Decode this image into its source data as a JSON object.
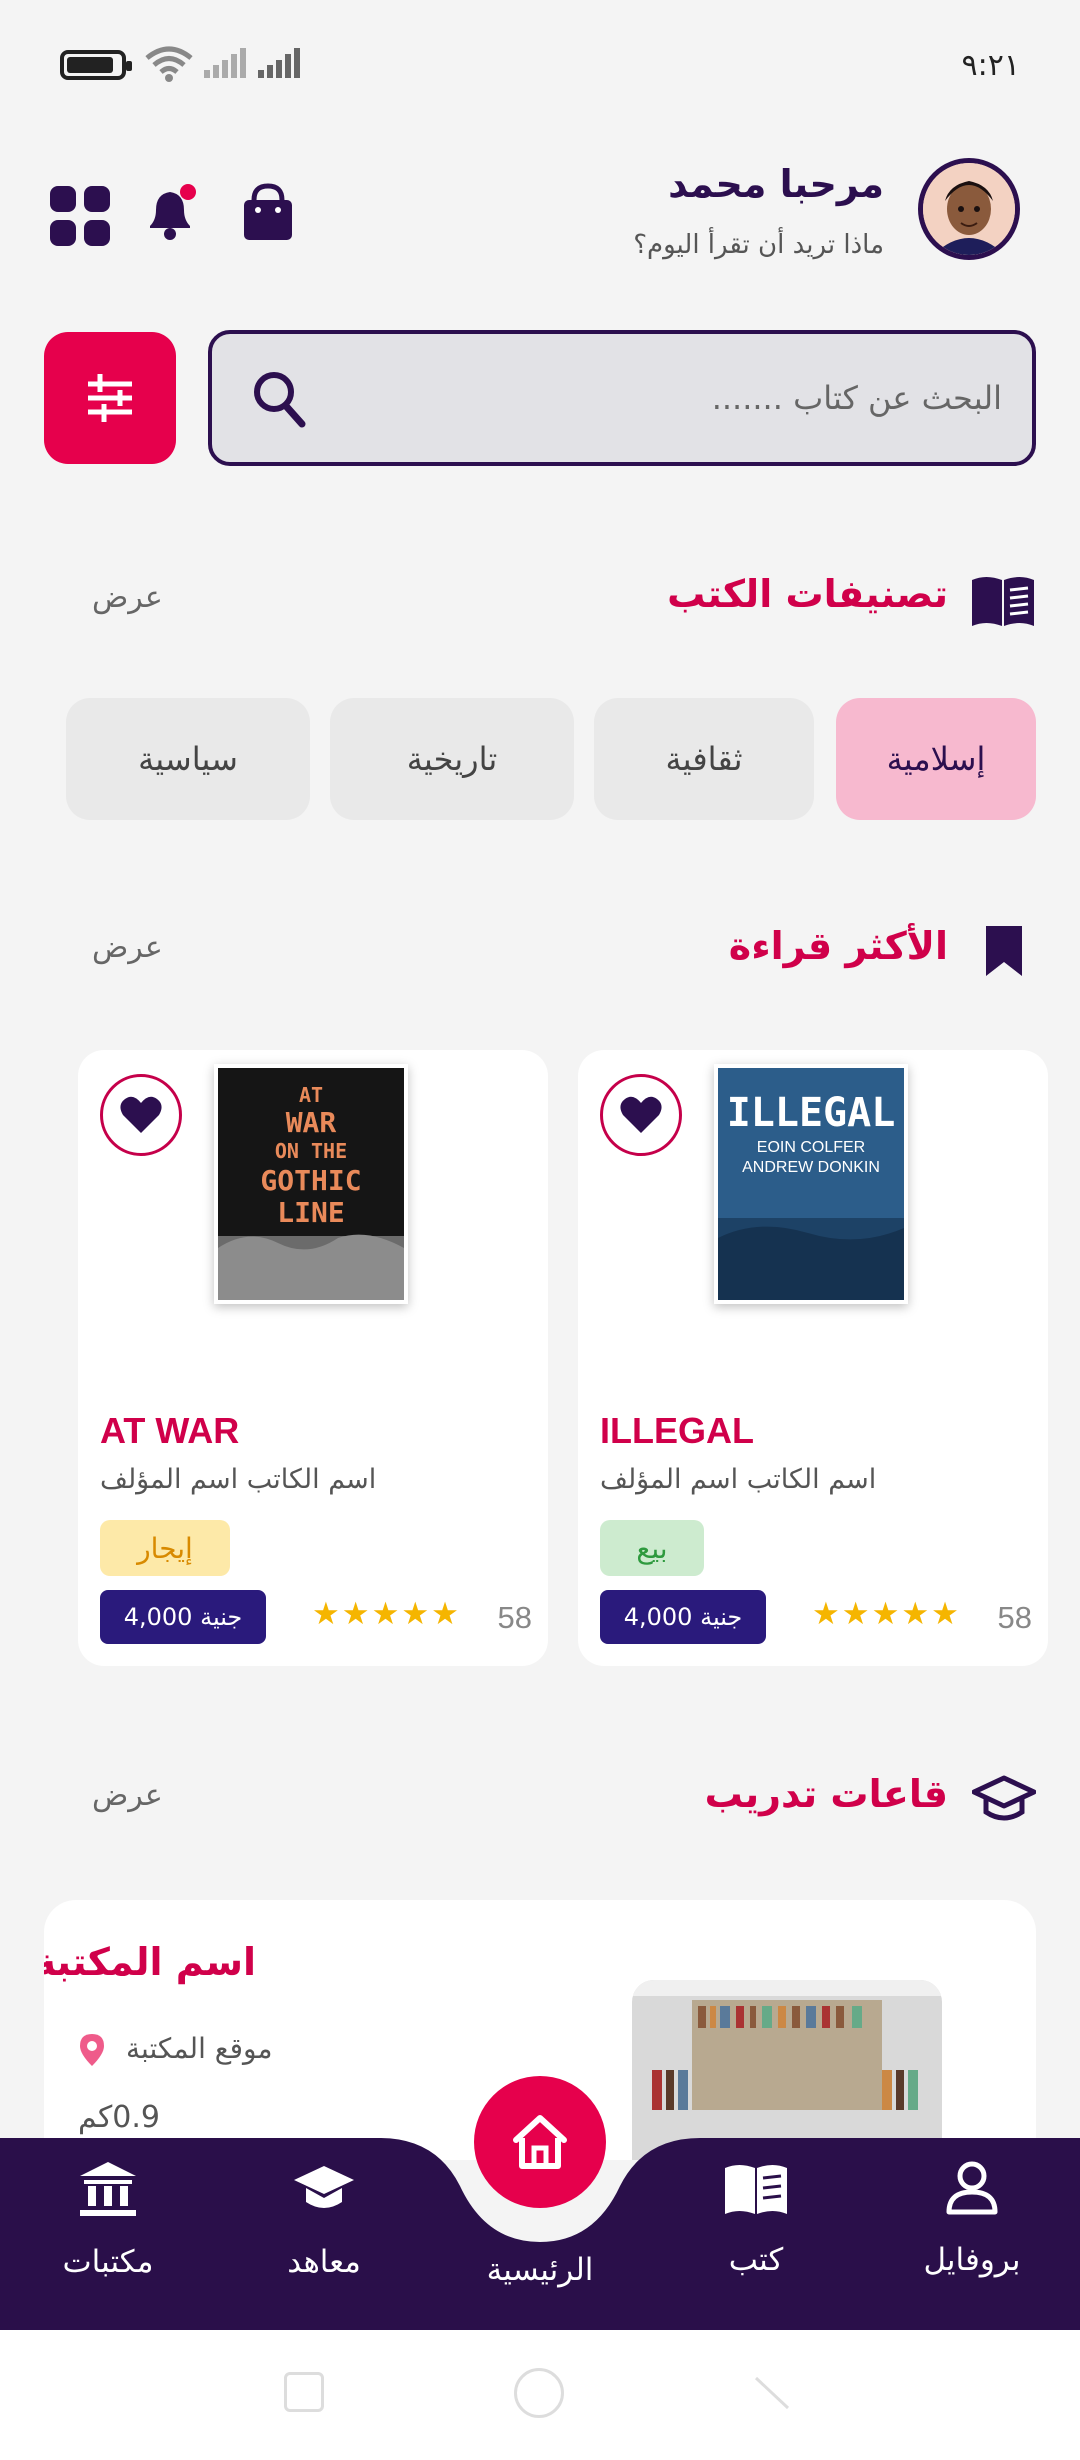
{
  "status_bar": {
    "time": "٩:٢١"
  },
  "header": {
    "greeting": "مرحبا محمد",
    "subtitle": "ماذا تريد أن تقرأ اليوم؟"
  },
  "search": {
    "placeholder": "البحث عن كتاب ......."
  },
  "categories_section": {
    "title": "تصنيفات الكتب",
    "more": "عرض",
    "items": [
      {
        "label": "إسلامية",
        "active": true
      },
      {
        "label": "ثقافية"
      },
      {
        "label": "تاريخية"
      },
      {
        "label": "سياسية"
      }
    ]
  },
  "most_read_section": {
    "title": "الأكثر قراءة",
    "more": "عرض",
    "books": [
      {
        "title": "ILLEGAL",
        "author": "اسم الكاتب اسم المؤلف",
        "type": "بيع",
        "price": "4,000 جنية",
        "rating_count": "58",
        "cover_lines": [
          "ILLEGAL",
          "EOIN COLFER",
          "ANDREW DONKIN"
        ],
        "type_color": "#2e9a3e"
      },
      {
        "title": "AT WAR",
        "author": "اسم الكاتب اسم المؤلف",
        "type": "إيجار",
        "price": "4,000 جنية",
        "rating_count": "58",
        "cover_lines": [
          "AT",
          "WAR",
          "ON THE",
          "GOTHIC",
          "LINE"
        ],
        "type_color": "#d88a00"
      }
    ]
  },
  "training_section": {
    "title": "قاعات تدريب",
    "more": "عرض",
    "library": {
      "name": "اسم المكتبة",
      "location": "موقع المكتبة",
      "distance": "0.9كم"
    }
  },
  "bottom_nav": {
    "items": [
      {
        "label": "مكتبات",
        "icon": "library-icon"
      },
      {
        "label": "معاهد",
        "icon": "graduation-cap-icon"
      },
      {
        "label": "الرئيسية",
        "icon": "home-icon"
      },
      {
        "label": "كتب",
        "icon": "book-icon"
      },
      {
        "label": "بروفايل",
        "icon": "user-icon"
      }
    ]
  },
  "colors": {
    "primary": "#e6004c",
    "dark_purple": "#2c0f4f",
    "nav_bg": "#2a0f4a",
    "price_bg": "#2a1a7c"
  }
}
